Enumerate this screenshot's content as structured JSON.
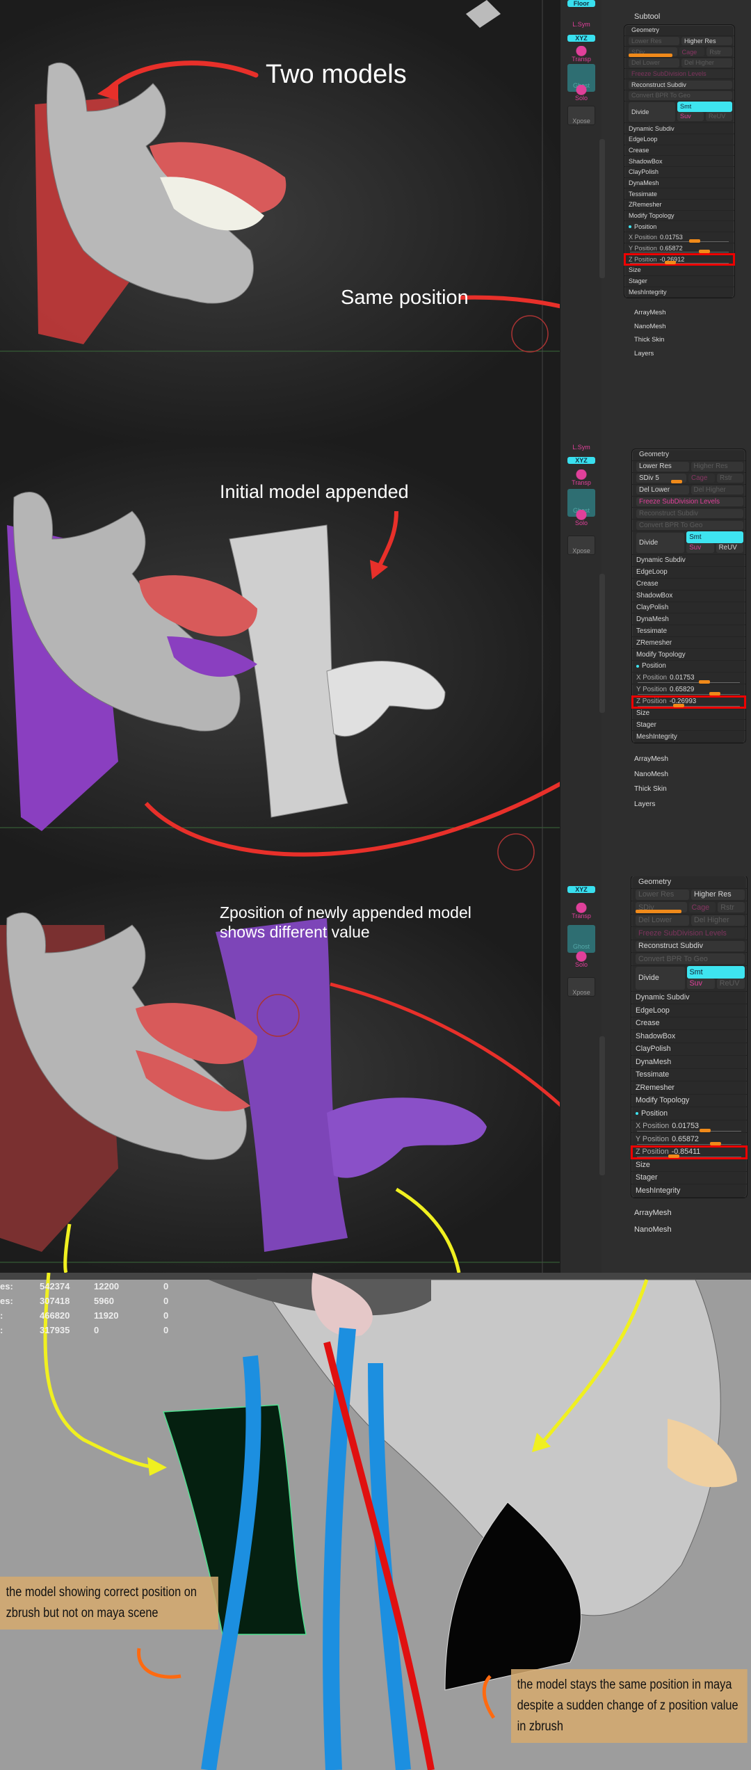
{
  "panels": [
    {
      "shelf": {
        "floor": "Floor",
        "lsym": "L.Sym",
        "xyz": "XYZ",
        "transp": "Transp",
        "ghost": "Ghost",
        "solo": "Solo",
        "xpose": "Xpose"
      },
      "subtool": "Subtool",
      "geometry": {
        "title": "Geometry",
        "lower_res": "Lower Res",
        "lower_res_enabled": false,
        "higher_res": "Higher Res",
        "higher_res_enabled": true,
        "sdiv": "SDiv",
        "sdiv_enabled": false,
        "cage": "Cage",
        "rstr": "Rstr",
        "del_lower": "Del Lower",
        "del_lower_enabled": false,
        "del_higher": "Del Higher",
        "del_higher_enabled": false,
        "freeze": "Freeze SubDivision Levels",
        "freeze_enabled": false,
        "reconstruct": "Reconstruct Subdiv",
        "reconstruct_enabled": true,
        "convert": "Convert BPR To Geo",
        "divide": "Divide",
        "smt": "Smt",
        "suv": "Suv",
        "reuv": "ReUV",
        "reuv_enabled": false,
        "items": [
          "Dynamic Subdiv",
          "EdgeLoop",
          "Crease",
          "ShadowBox",
          "ClayPolish",
          "DynaMesh",
          "Tessimate",
          "ZRemesher",
          "Modify Topology"
        ],
        "position": "Position",
        "x_label": "X Position",
        "x": "0.01753",
        "y_label": "Y Position",
        "y": "0.65872",
        "z_label": "Z Position",
        "z": "-0.26912",
        "x_slider": 0.6,
        "y_slider": 0.7,
        "z_slider": 0.35,
        "tail": [
          "Size",
          "Stager",
          "MeshIntegrity"
        ]
      },
      "menus": [
        "ArrayMesh",
        "NanoMesh",
        "Thick Skin",
        "Layers"
      ]
    },
    {
      "shelf": {
        "lsym": "L.Sym",
        "xyz": "XYZ",
        "transp": "Transp",
        "ghost": "Ghost",
        "solo": "Solo",
        "xpose": "Xpose"
      },
      "geometry": {
        "title": "Geometry",
        "lower_res": "Lower Res",
        "lower_res_enabled": true,
        "higher_res": "Higher Res",
        "higher_res_enabled": false,
        "sdiv": "SDiv 5",
        "sdiv_enabled": true,
        "cage": "Cage",
        "rstr": "Rstr",
        "del_lower": "Del Lower",
        "del_lower_enabled": true,
        "del_higher": "Del Higher",
        "del_higher_enabled": false,
        "freeze": "Freeze SubDivision Levels",
        "freeze_enabled": true,
        "reconstruct": "Reconstruct Subdiv",
        "reconstruct_enabled": false,
        "convert": "Convert BPR To Geo",
        "divide": "Divide",
        "smt": "Smt",
        "suv": "Suv",
        "reuv": "ReUV",
        "reuv_enabled": true,
        "items": [
          "Dynamic Subdiv",
          "EdgeLoop",
          "Crease",
          "ShadowBox",
          "ClayPolish",
          "DynaMesh",
          "Tessimate",
          "ZRemesher",
          "Modify Topology"
        ],
        "position": "Position",
        "x_label": "X Position",
        "x": "0.01753",
        "y_label": "Y Position",
        "y": "0.65829",
        "z_label": "Z Position",
        "z": "-0.26993",
        "x_slider": 0.6,
        "y_slider": 0.7,
        "z_slider": 0.35,
        "tail": [
          "Size",
          "Stager",
          "MeshIntegrity"
        ]
      },
      "menus": [
        "ArrayMesh",
        "NanoMesh",
        "Thick Skin",
        "Layers"
      ]
    },
    {
      "shelf": {
        "xyz": "XYZ",
        "transp": "Transp",
        "ghost": "Ghost",
        "solo": "Solo",
        "xpose": "Xpose"
      },
      "geometry": {
        "title": "Geometry",
        "lower_res": "Lower Res",
        "lower_res_enabled": false,
        "higher_res": "Higher Res",
        "higher_res_enabled": true,
        "sdiv": "SDiv",
        "sdiv_enabled": false,
        "cage": "Cage",
        "rstr": "Rstr",
        "del_lower": "Del Lower",
        "del_lower_enabled": false,
        "del_higher": "Del Higher",
        "del_higher_enabled": false,
        "freeze": "Freeze SubDivision Levels",
        "freeze_enabled": false,
        "reconstruct": "Reconstruct Subdiv",
        "reconstruct_enabled": true,
        "convert": "Convert BPR To Geo",
        "divide": "Divide",
        "smt": "Smt",
        "suv": "Suv",
        "reuv": "ReUV",
        "reuv_enabled": false,
        "items": [
          "Dynamic Subdiv",
          "EdgeLoop",
          "Crease",
          "ShadowBox",
          "ClayPolish",
          "DynaMesh",
          "Tessimate",
          "ZRemesher",
          "Modify Topology"
        ],
        "position": "Position",
        "x_label": "X Position",
        "x": "0.01753",
        "y_label": "Y Position",
        "y": "0.65872",
        "z_label": "Z Position",
        "z": "-0.85411",
        "x_slider": 0.6,
        "y_slider": 0.7,
        "z_slider": 0.3,
        "tail": [
          "Size",
          "Stager",
          "MeshIntegrity"
        ]
      },
      "menus": [
        "ArrayMesh",
        "NanoMesh"
      ]
    }
  ],
  "annotations": {
    "two_models": "Two models",
    "same_position": "Same position",
    "initial_appended": "Initial model appended",
    "zpos_line1": "Zposition of newly appended model",
    "zpos_line2": "shows different value"
  },
  "maya": {
    "stats": [
      [
        "es:",
        "542374",
        "12200",
        "0"
      ],
      [
        "es:",
        "307418",
        "5960",
        "0"
      ],
      [
        ":",
        "466820",
        "11920",
        "0"
      ],
      [
        ":",
        "317935",
        "0",
        "0"
      ]
    ],
    "note_left": "the model showing correct position on zbrush but not on maya scene",
    "note_right": "the model stays the same position in maya despite a sudden change of z position value in zbrush"
  },
  "colors": {
    "accent": "#3ee4f0",
    "highlight": "#e00000",
    "annotation_arrow": "#e8302a",
    "yellow_arrow": "#f0f020",
    "orange_arrow": "#ff6a10"
  }
}
